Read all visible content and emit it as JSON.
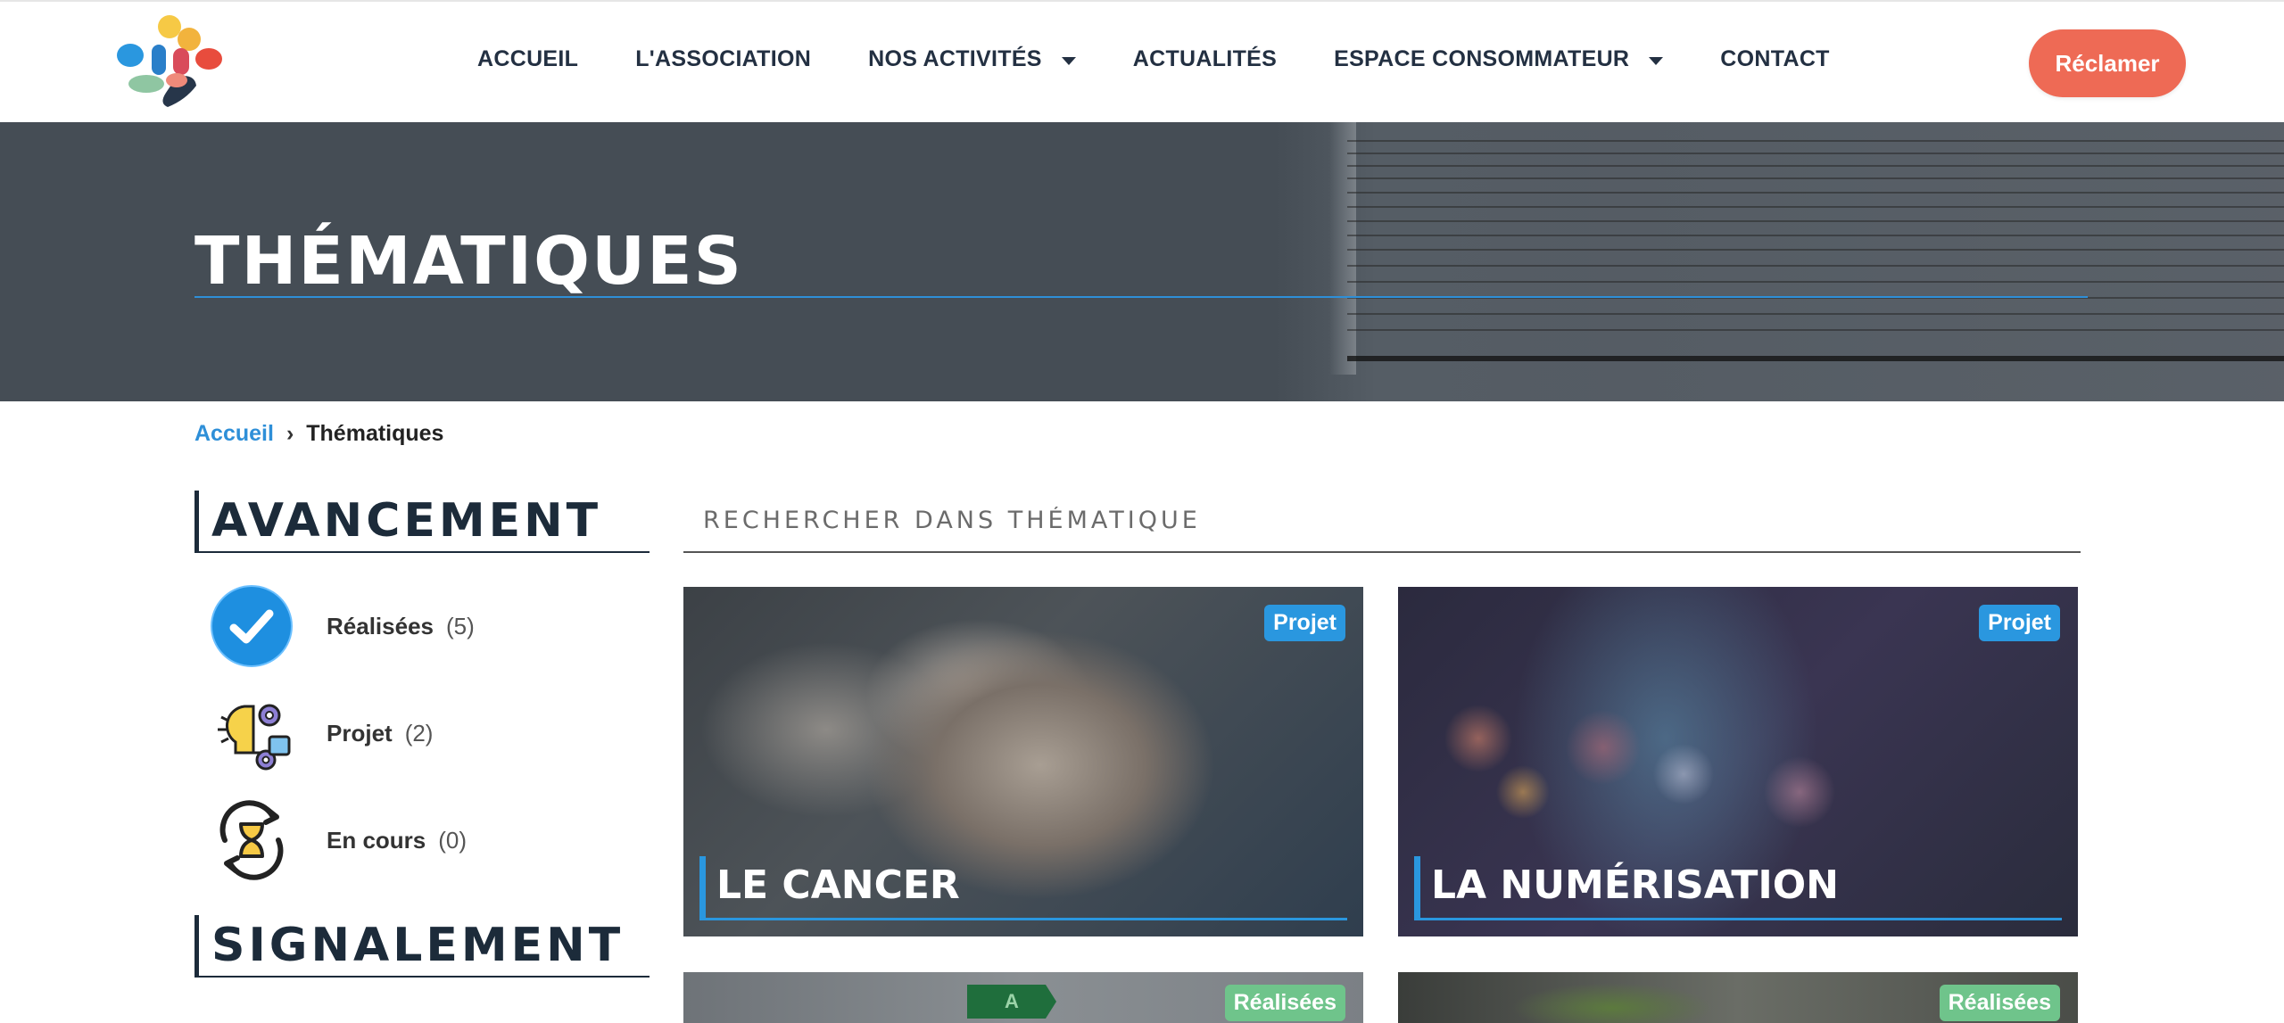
{
  "nav": {
    "items": [
      {
        "label": "ACCUEIL",
        "dropdown": false
      },
      {
        "label": "L'ASSOCIATION",
        "dropdown": false
      },
      {
        "label": "NOS ACTIVITÉS",
        "dropdown": true
      },
      {
        "label": "ACTUALITÉS",
        "dropdown": false
      },
      {
        "label": "ESPACE CONSOMMATEUR",
        "dropdown": true
      },
      {
        "label": "CONTACT",
        "dropdown": false
      }
    ],
    "cta_label": "Réclamer"
  },
  "hero": {
    "title": "THÉMATIQUES"
  },
  "breadcrumb": {
    "home": "Accueil",
    "separator": "›",
    "current": "Thématiques"
  },
  "sidebar": {
    "avancement_title": "AVANCEMENT",
    "statuses": [
      {
        "label": "Réalisées",
        "count": "(5)",
        "icon": "check-circle-icon"
      },
      {
        "label": "Projet",
        "count": "(2)",
        "icon": "lightbulb-gears-icon"
      },
      {
        "label": "En cours",
        "count": "(0)",
        "icon": "hourglass-refresh-icon"
      }
    ],
    "signalement_title": "SIGNALEMENT"
  },
  "search": {
    "placeholder": "RECHERCHER DANS THÉMATIQUE"
  },
  "cards": [
    {
      "title": "LE CANCER",
      "badge": "Projet"
    },
    {
      "title": "LA NUMÉRISATION",
      "badge": "Projet"
    },
    {
      "title": "",
      "badge": "Réalisées"
    },
    {
      "title": "",
      "badge": "Réalisées"
    }
  ],
  "colors": {
    "accent": "#2a97df",
    "cta": "#ee6a55",
    "heading": "#1c2b3a",
    "badge_done": "#6fc48b"
  }
}
